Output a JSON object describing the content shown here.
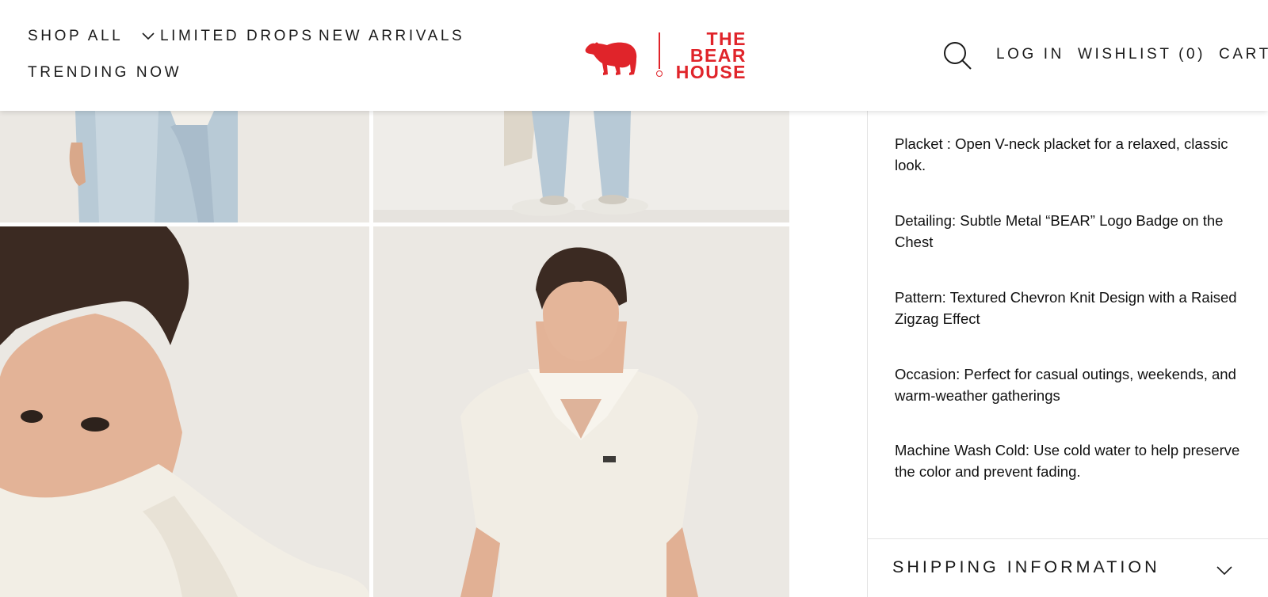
{
  "header": {
    "nav": {
      "shop_all": "SHOP ALL",
      "limited_drops": "LIMITED DROPS",
      "new_arrivals": "NEW ARRIVALS",
      "trending_now": "TRENDING NOW"
    },
    "logo": {
      "line1": "THE",
      "line2": "BEAR",
      "line3": "HOUSE",
      "icon": "bear-icon",
      "color": "#e0242a"
    },
    "search_icon": "search-icon",
    "login": "LOG IN",
    "wishlist": "WISHLIST (0)",
    "cart": "CART"
  },
  "details": [
    "Placket : Open V-neck placket for a relaxed, classic look.",
    "Detailing: Subtle Metal “BEAR” Logo Badge on the Chest",
    "Pattern: Textured Chevron Knit Design with a Raised Zigzag Effect",
    "Occasion:  Perfect for casual outings, weekends, and warm-weather gatherings",
    "Machine Wash Cold: Use cold water to help preserve the color and prevent fading."
  ],
  "shipping": {
    "label": "SHIPPING INFORMATION",
    "icon": "chevron-down-icon"
  }
}
